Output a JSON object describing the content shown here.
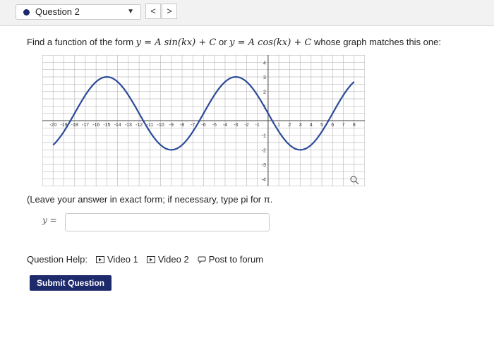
{
  "header": {
    "question_select": "Question 2",
    "prev_label": "<",
    "next_label": ">"
  },
  "prompt": {
    "lead": "Find a function of the form",
    "form1": "y = A sin(kx) + C",
    "or": "or",
    "form2": "y = A cos(kx) + C",
    "tail": "whose graph matches this one:"
  },
  "graph": {
    "x_ticks": [
      "-20",
      "-19",
      "-18",
      "-17",
      "-16",
      "-15",
      "-14",
      "-13",
      "-12",
      "-11",
      "-10",
      "-9",
      "-8",
      "-7",
      "-6",
      "-5",
      "-4",
      "-3",
      "-2",
      "-1",
      "1",
      "2",
      "3",
      "4",
      "5",
      "6",
      "7",
      "8"
    ],
    "y_ticks": [
      "4",
      "3",
      "2",
      "1",
      "-1",
      "-2",
      "-3",
      "-4"
    ],
    "curve_color": "#2b4a9a",
    "x_range": [
      -21,
      9
    ],
    "y_range": [
      -4.5,
      4.5
    ],
    "curve_description": "cosine wave, max 3 at x=-3, min -2 at x=-9"
  },
  "chart_data": {
    "type": "line",
    "xlim": [
      -21,
      9
    ],
    "ylim": [
      -4.5,
      4.5
    ],
    "grid": true,
    "x": [
      -20,
      -18,
      -15,
      -12,
      -9,
      -6,
      -3,
      0,
      3,
      6,
      8
    ],
    "y": [
      -1,
      1.2,
      3,
      0.5,
      -2,
      0.5,
      3,
      0.5,
      -2,
      0.5,
      1.9
    ]
  },
  "note": "(Leave your answer in exact form; if necessary, type pi for π.",
  "answer": {
    "label": "y =",
    "value": ""
  },
  "help": {
    "label": "Question Help:",
    "video1": "Video 1",
    "video2": "Video 2",
    "forum": "Post to forum"
  },
  "submit_label": "Submit Question"
}
